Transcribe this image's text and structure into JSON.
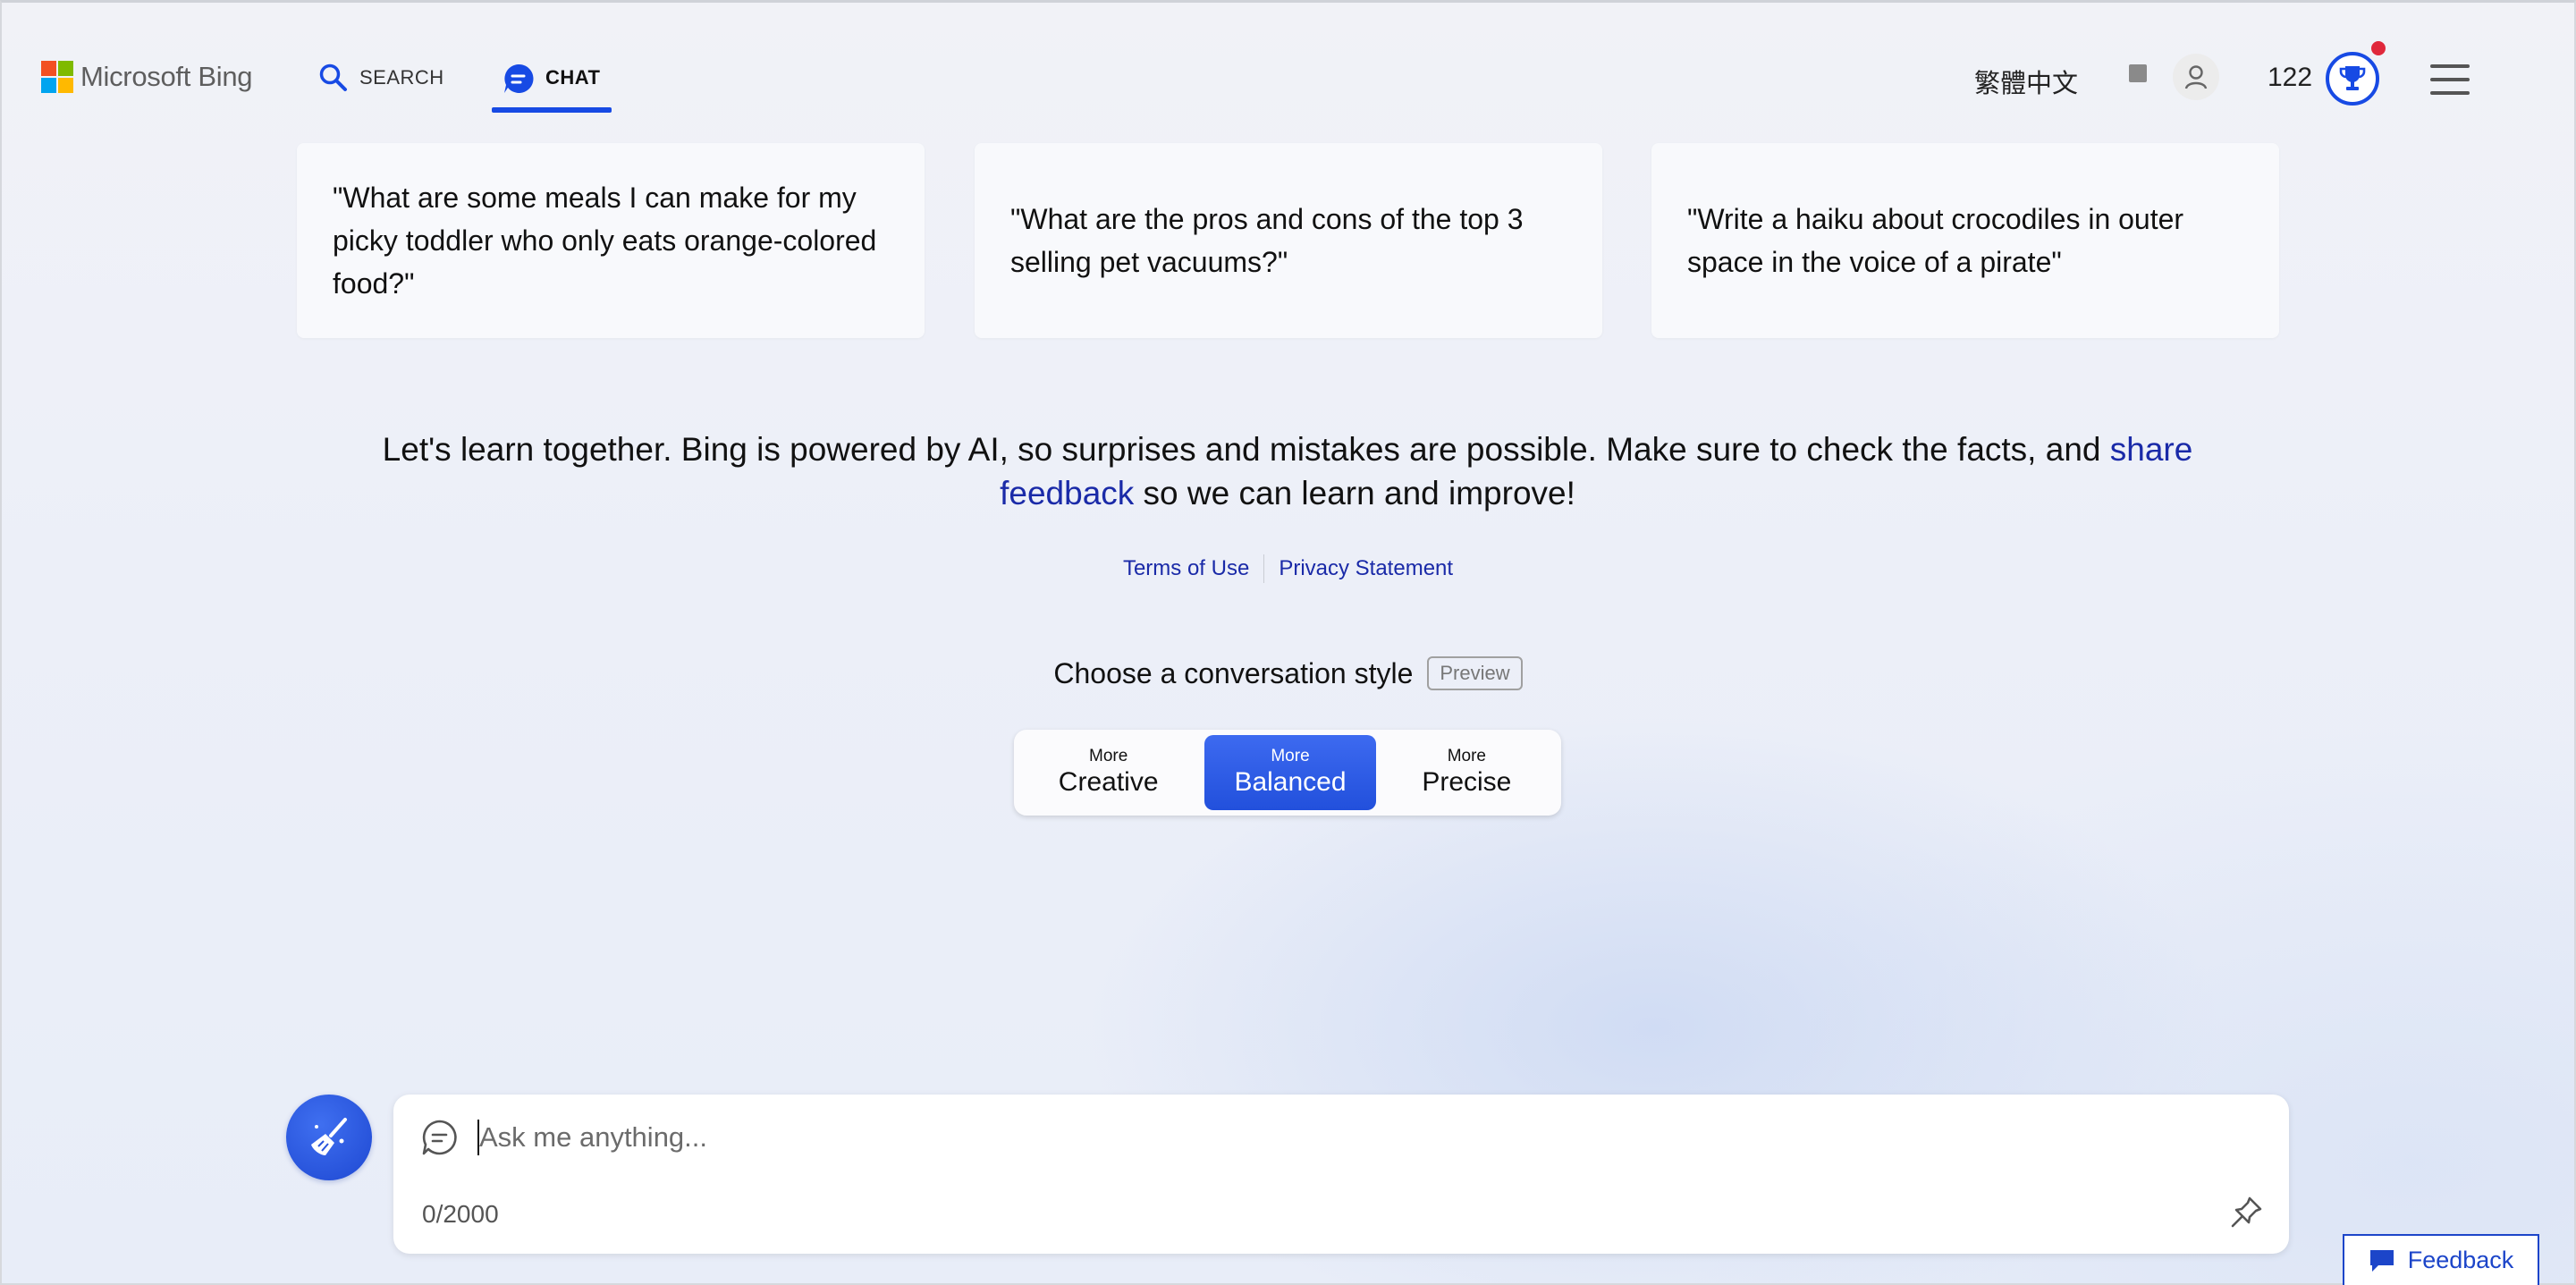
{
  "header": {
    "brand": "Microsoft Bing",
    "nav": {
      "search_label": "SEARCH",
      "chat_label": "CHAT"
    },
    "language": "繁體中文",
    "points": "122",
    "accent_color": "#174ae4"
  },
  "suggestions": [
    {
      "text": "\"What are some meals I can make for my picky toddler who only eats orange-colored food?\""
    },
    {
      "text": "\"What are the pros and cons of the top 3 selling pet vacuums?\""
    },
    {
      "text": "\"Write a haiku about crocodiles in outer space in the voice of a pirate\""
    }
  ],
  "disclaimer": {
    "text_before": "Let's learn together. Bing is powered by AI, so surprises and mistakes are possible. Make sure to check the facts, and ",
    "link": "share feedback",
    "text_after": " so we can learn and improve!"
  },
  "legal": {
    "terms": "Terms of Use",
    "privacy": "Privacy Statement"
  },
  "conversation_style": {
    "title": "Choose a conversation style",
    "badge": "Preview",
    "selected": "Balanced",
    "options": [
      {
        "top": "More",
        "bottom": "Creative"
      },
      {
        "top": "More",
        "bottom": "Balanced"
      },
      {
        "top": "More",
        "bottom": "Precise"
      }
    ]
  },
  "composer": {
    "placeholder": "Ask me anything...",
    "value": "",
    "char_count": "0/2000"
  },
  "feedback": {
    "label": "Feedback"
  },
  "icons": {
    "search": "search-icon",
    "chat": "chat-bubble-icon",
    "rewards": "rewards-icon",
    "avatar": "user-icon",
    "trophy": "trophy-icon",
    "menu": "hamburger-menu-icon",
    "new_topic": "broom-icon",
    "pin": "pin-icon",
    "feedback": "feedback-icon"
  }
}
